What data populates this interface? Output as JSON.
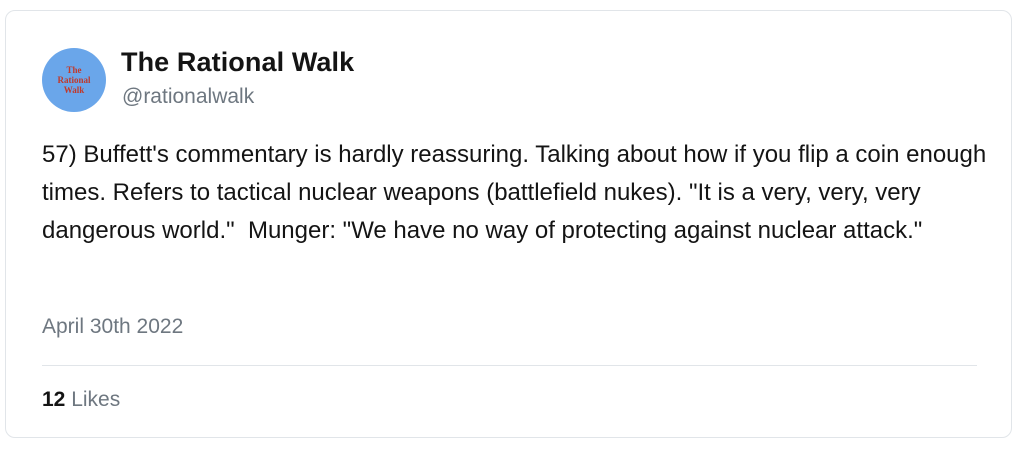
{
  "profile": {
    "avatar_line1": "The",
    "avatar_line2": "Rational",
    "avatar_line3": "Walk",
    "display_name": "The Rational Walk",
    "handle": "@rationalwalk"
  },
  "tweet": {
    "text": "57) Buffett's commentary is hardly reassuring. Talking about how if you flip a coin enough times. Refers to tactical nuclear weapons (battlefield nukes). \"It is a very, very, very dangerous world.\"  Munger: \"We have no way of protecting against nuclear attack.\"",
    "date": "April 30th 2022",
    "likes_count": "12",
    "likes_label": "Likes"
  },
  "colors": {
    "avatar_bg": "#6aa6ea",
    "avatar_text": "#c0392b",
    "text_primary": "#141414",
    "text_secondary": "#6e7780",
    "border": "#e1e5e9"
  }
}
